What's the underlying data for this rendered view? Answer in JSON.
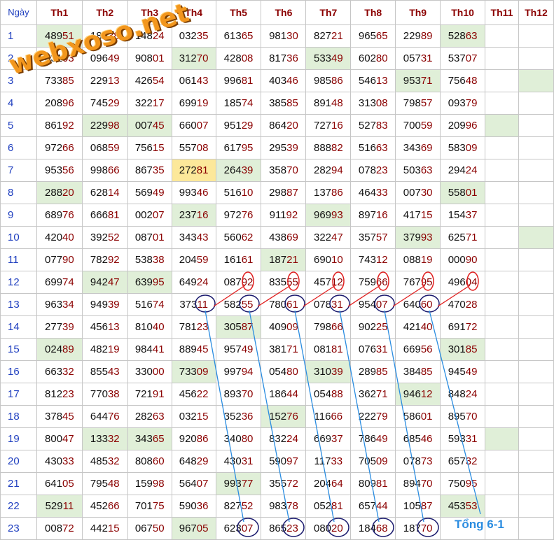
{
  "header": {
    "day_label": "Ngày",
    "columns": [
      "Th1",
      "Th2",
      "Th3",
      "Th4",
      "Th5",
      "Th6",
      "Th7",
      "Th8",
      "Th9",
      "Th10",
      "Th11",
      "Th12"
    ]
  },
  "rows": [
    {
      "day": "1",
      "cells": [
        "48951",
        "18838",
        "14824",
        "03235",
        "61365",
        "98130",
        "82721",
        "96565",
        "22989",
        "52863",
        "",
        ""
      ]
    },
    {
      "day": "2",
      "cells": [
        "03103",
        "09649",
        "90801",
        "31270",
        "42808",
        "81736",
        "53349",
        "60280",
        "05731",
        "53707",
        "",
        ""
      ]
    },
    {
      "day": "3",
      "cells": [
        "73385",
        "22913",
        "42654",
        "06143",
        "99681",
        "40346",
        "98586",
        "54613",
        "95371",
        "75648",
        "",
        ""
      ]
    },
    {
      "day": "4",
      "cells": [
        "20896",
        "74529",
        "32217",
        "69919",
        "18574",
        "38585",
        "89148",
        "31308",
        "79857",
        "09379",
        "",
        ""
      ]
    },
    {
      "day": "5",
      "cells": [
        "86192",
        "22998",
        "00745",
        "66007",
        "95129",
        "86420",
        "72716",
        "52783",
        "70059",
        "20996",
        "",
        ""
      ]
    },
    {
      "day": "6",
      "cells": [
        "97266",
        "06859",
        "75615",
        "55708",
        "61795",
        "29539",
        "88882",
        "51663",
        "34369",
        "58309",
        "",
        ""
      ]
    },
    {
      "day": "7",
      "cells": [
        "95356",
        "99866",
        "86735",
        "27281",
        "26439",
        "35870",
        "28294",
        "07823",
        "50363",
        "29424",
        "",
        ""
      ]
    },
    {
      "day": "8",
      "cells": [
        "28820",
        "62814",
        "56949",
        "99346",
        "51610",
        "29887",
        "13786",
        "46433",
        "00730",
        "55801",
        "",
        ""
      ]
    },
    {
      "day": "9",
      "cells": [
        "68976",
        "66681",
        "00207",
        "23716",
        "97276",
        "91192",
        "96993",
        "89716",
        "41715",
        "15437",
        "",
        ""
      ]
    },
    {
      "day": "10",
      "cells": [
        "42040",
        "39252",
        "08701",
        "34343",
        "56062",
        "43869",
        "32247",
        "35757",
        "37993",
        "62571",
        "",
        ""
      ]
    },
    {
      "day": "11",
      "cells": [
        "07790",
        "78292",
        "53838",
        "20459",
        "16161",
        "18721",
        "69010",
        "74312",
        "08819",
        "00090",
        "",
        ""
      ]
    },
    {
      "day": "12",
      "cells": [
        "69974",
        "94247",
        "63995",
        "64924",
        "08792",
        "83555",
        "45712",
        "75966",
        "76795",
        "49604",
        "",
        ""
      ]
    },
    {
      "day": "13",
      "cells": [
        "96334",
        "94939",
        "51674",
        "37311",
        "58255",
        "78061",
        "07831",
        "95407",
        "64060",
        "47028",
        "",
        ""
      ]
    },
    {
      "day": "14",
      "cells": [
        "27739",
        "45613",
        "81040",
        "78123",
        "30587",
        "40909",
        "79866",
        "90225",
        "42140",
        "69172",
        "",
        ""
      ]
    },
    {
      "day": "15",
      "cells": [
        "02489",
        "48219",
        "98441",
        "88945",
        "95749",
        "38171",
        "08181",
        "07631",
        "66956",
        "30185",
        "",
        ""
      ]
    },
    {
      "day": "16",
      "cells": [
        "66332",
        "85543",
        "33000",
        "73309",
        "99794",
        "05480",
        "31039",
        "28985",
        "38485",
        "94549",
        "",
        ""
      ]
    },
    {
      "day": "17",
      "cells": [
        "81223",
        "77038",
        "72191",
        "45622",
        "89370",
        "18644",
        "05488",
        "36271",
        "94612",
        "84824",
        "",
        ""
      ]
    },
    {
      "day": "18",
      "cells": [
        "37845",
        "64476",
        "28263",
        "03215",
        "35236",
        "15276",
        "11666",
        "22279",
        "58601",
        "89570",
        "",
        ""
      ]
    },
    {
      "day": "19",
      "cells": [
        "80047",
        "13332",
        "34365",
        "92086",
        "34080",
        "83224",
        "66937",
        "78649",
        "68546",
        "59331",
        "",
        ""
      ]
    },
    {
      "day": "20",
      "cells": [
        "43033",
        "48532",
        "80860",
        "64829",
        "43031",
        "59097",
        "11733",
        "70509",
        "07873",
        "65732",
        "",
        ""
      ]
    },
    {
      "day": "21",
      "cells": [
        "64105",
        "79548",
        "15998",
        "56407",
        "99377",
        "35572",
        "20464",
        "80981",
        "89470",
        "75095",
        "",
        ""
      ]
    },
    {
      "day": "22",
      "cells": [
        "52911",
        "45266",
        "70175",
        "59036",
        "82752",
        "98378",
        "05281",
        "65744",
        "10587",
        "45353",
        "",
        ""
      ]
    },
    {
      "day": "23",
      "cells": [
        "00872",
        "44215",
        "06750",
        "96705",
        "62307",
        "86523",
        "08020",
        "18468",
        "18770",
        "",
        "",
        ""
      ]
    }
  ],
  "annotation": {
    "site_logo": "webxoso.net",
    "note": "Tổng 6-1",
    "note_color": "#2a8ce0",
    "red_circle_color": "#e02020",
    "navy_circle_color": "#1a1a6e",
    "highlight_color": "#e0efd8",
    "yellow_color": "#fce89a"
  }
}
